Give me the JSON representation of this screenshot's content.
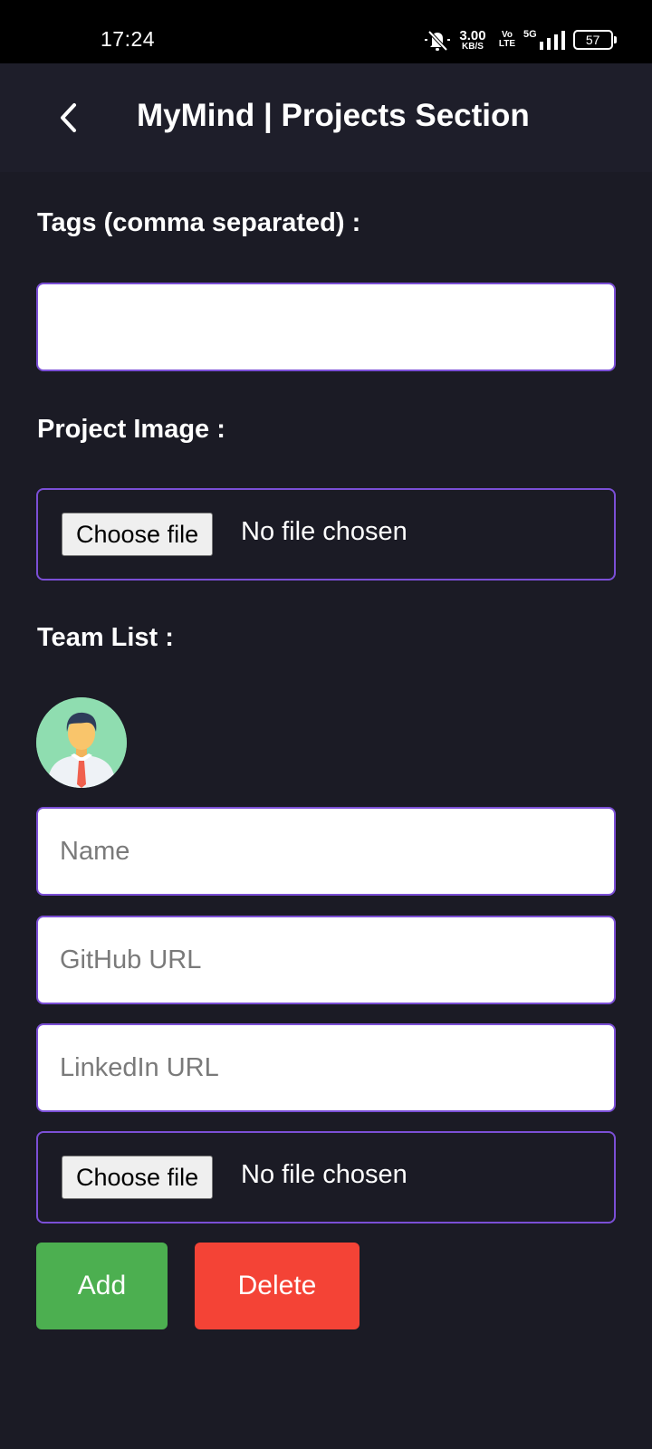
{
  "status_bar": {
    "time": "17:24",
    "net_speed_value": "3.00",
    "net_speed_unit": "KB/S",
    "volte_top": "Vo",
    "volte_bottom": "LTE",
    "network_type": "5G",
    "battery": "57"
  },
  "header": {
    "title": "MyMind | Projects Section",
    "back_icon": "chevron-left-icon"
  },
  "form": {
    "tags_label": "Tags (comma separated) :",
    "tags_value": "",
    "project_image_label": "Project Image :",
    "project_image": {
      "button_label": "Choose file",
      "status": "No file chosen"
    },
    "team_list_label": "Team List :",
    "member": {
      "avatar_icon": "person-avatar-icon",
      "name_placeholder": "Name",
      "github_placeholder": "GitHub URL",
      "linkedin_placeholder": "LinkedIn URL",
      "photo": {
        "button_label": "Choose file",
        "status": "No file chosen"
      }
    },
    "add_label": "Add",
    "delete_label": "Delete"
  },
  "colors": {
    "background": "#1b1b25",
    "header": "#1e1e2a",
    "input_border": "#7b4fd6",
    "add_button": "#4caf50",
    "delete_button": "#f44336"
  }
}
